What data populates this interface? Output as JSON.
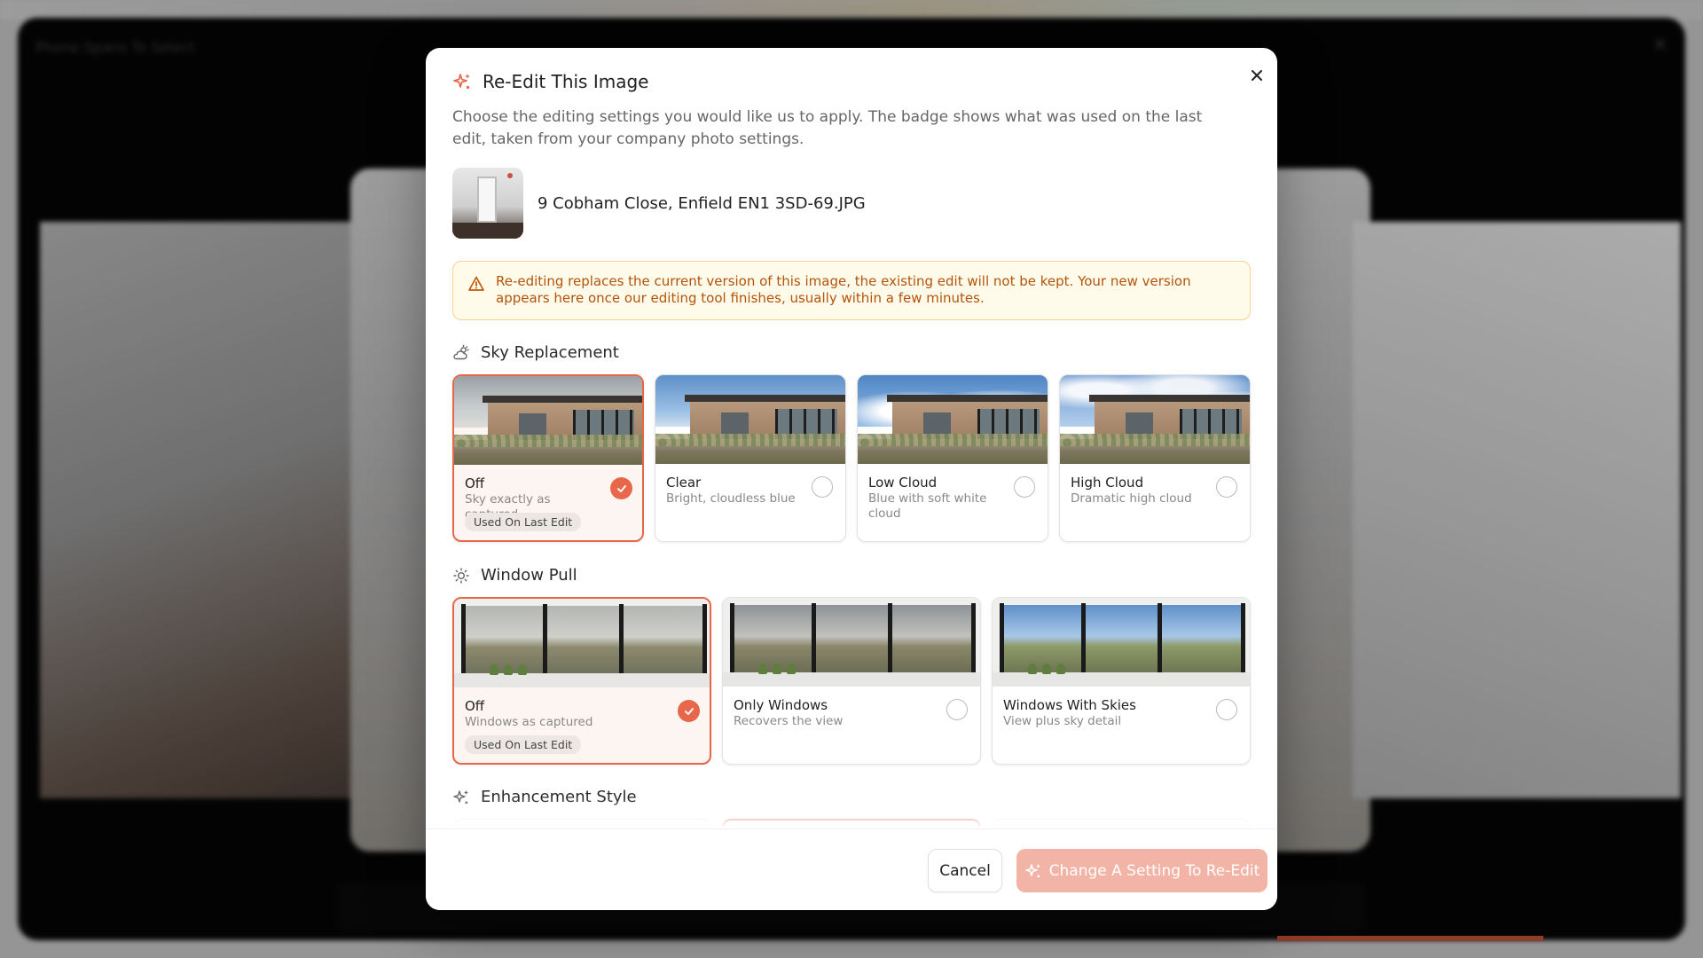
{
  "background": {
    "viewer_title": "Phone Spans To Select"
  },
  "modal": {
    "title": "Re-Edit This Image",
    "subtitle": "Choose the editing settings you would like us to apply. The badge shows what was used on the last edit, taken from your company photo settings.",
    "file_name": "9 Cobham Close, Enfield EN1 3SD-69.JPG",
    "warning": "Re-editing replaces the current version of this image, the existing edit will not be kept. Your new version appears here once our editing tool finishes, usually within a few minutes.",
    "icons": {
      "title": "sparkles-icon",
      "close": "close-icon",
      "warning": "warning-triangle-icon"
    }
  },
  "sky_replacement": {
    "title": "Sky Replacement",
    "icon": "cloud-sun-icon",
    "options": [
      {
        "label": "Off",
        "desc": "Sky exactly as captured",
        "selected": true,
        "badge": "Used On Last Edit"
      },
      {
        "label": "Clear",
        "desc": "Bright, cloudless blue",
        "selected": false
      },
      {
        "label": "Low Cloud",
        "desc": "Blue with soft white cloud",
        "selected": false
      },
      {
        "label": "High Cloud",
        "desc": "Dramatic high cloud",
        "selected": false
      }
    ]
  },
  "window_pull": {
    "title": "Window Pull",
    "icon": "sun-icon",
    "options": [
      {
        "label": "Off",
        "desc": "Windows as captured",
        "selected": true,
        "badge": "Used On Last Edit"
      },
      {
        "label": "Only Windows",
        "desc": "Recovers the view",
        "selected": false
      },
      {
        "label": "Windows With Skies",
        "desc": "View plus sky detail",
        "selected": false
      }
    ]
  },
  "enhancement_style": {
    "title": "Enhancement Style",
    "icon": "sparkles-icon"
  },
  "footer": {
    "cancel_label": "Cancel",
    "submit_label": "Change A Setting To Re-Edit",
    "submit_disabled": true
  },
  "colors": {
    "accent": "#e8664a",
    "accent_disabled": "#f2b4a6",
    "warning_bg": "#fffbeb",
    "warning_text": "#b45309"
  }
}
